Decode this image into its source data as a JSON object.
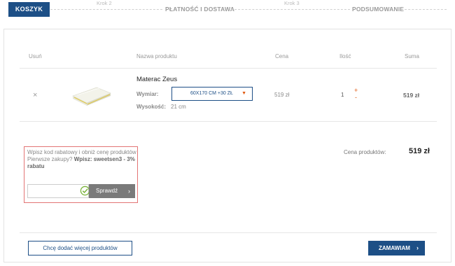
{
  "steps": {
    "active": "KOSZYK",
    "step2_small": "Krok 2",
    "step2_big": "PŁATNOŚĆ I DOSTAWA",
    "step3_small": "Krok 3",
    "step3_big": "PODSUMOWANIE"
  },
  "table": {
    "headers": {
      "remove": "Usuń",
      "name": "Nazwa produktu",
      "price": "Cena",
      "qty": "Ilość",
      "sum": "Suma"
    },
    "row": {
      "remove_icon": "×",
      "name": "Materac Zeus",
      "size_label": "Wymiar:",
      "size_value": "60X170 CM +30 ZŁ",
      "height_label": "Wysokość:",
      "height_value": "21 cm",
      "price": "519 zł",
      "qty": "1",
      "plus": "+",
      "minus": "-",
      "sum": "519 zł"
    }
  },
  "coupon": {
    "line1": "Wpisz kod rabatowy i obniż cenę produktów",
    "line2_prefix": "Pierwsze zakupy? ",
    "line2_bold": "Wpisz: sweetsen3 - 3% rabatu",
    "input_value": "",
    "button": "Sprawdź"
  },
  "totals": {
    "label": "Cena produktów:",
    "value": "519 zł"
  },
  "actions": {
    "more_products": "Chcę dodać więcej produktów",
    "order": "ZAMAWIAM"
  },
  "colors": {
    "brand_blue": "#1d4f86",
    "accent_orange": "#e05a12",
    "coupon_border": "#e37474",
    "check_green": "#7ab33a"
  }
}
